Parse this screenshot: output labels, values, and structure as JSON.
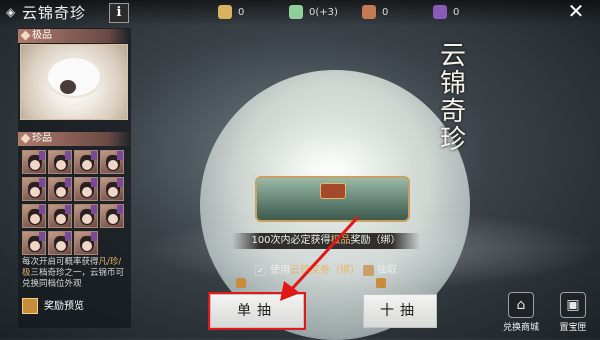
{
  "header": {
    "title": "云锦奇珍",
    "info_label": "i",
    "resources": [
      {
        "icon": "coin-icon",
        "value": "0"
      },
      {
        "icon": "key-icon",
        "value": "0(+3)"
      },
      {
        "icon": "ticket-icon",
        "value": "0"
      },
      {
        "icon": "potion-icon",
        "value": "0"
      }
    ],
    "close_label": "✕"
  },
  "left_panel": {
    "top_section_label": "极品",
    "second_section_label": "珍品",
    "description": {
      "part1": "每次开启可概率获得",
      "highlight": "凡/珍/极",
      "part2": "三档奇珍之一，云锦币可兑换同档位外观"
    },
    "preview_label": "奖励预览"
  },
  "logo_chars": [
    "云",
    "锦",
    "奇",
    "珍"
  ],
  "banner": {
    "prefix": "100次内必定获得",
    "highlight": "极品",
    "suffix": "奖励（绑）"
  },
  "ticket_row": {
    "checked": true,
    "prefix": "使用",
    "highlight": "云锦奖券（绑）",
    "suffix": "抽取"
  },
  "buttons": {
    "single": "单抽",
    "ten": "十抽"
  },
  "shortcuts": {
    "shop": "兑换商城",
    "treasure": "置宝匣"
  },
  "colors": {
    "highlight": "#e8b46a",
    "annotation_red": "#e01818"
  }
}
